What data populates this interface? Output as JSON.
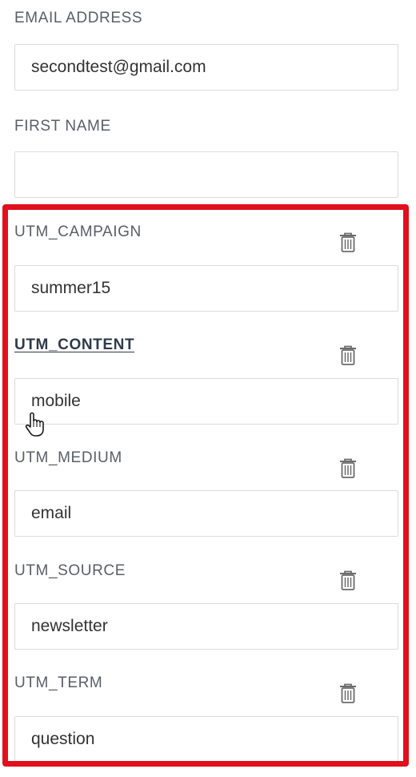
{
  "fields": {
    "email": {
      "label": "EMAIL ADDRESS",
      "value": "secondtest@gmail.com"
    },
    "first_name": {
      "label": "FIRST NAME",
      "value": ""
    },
    "utm_campaign": {
      "label": "UTM_CAMPAIGN",
      "value": "summer15"
    },
    "utm_content": {
      "label": "UTM_CONTENT",
      "value": "mobile"
    },
    "utm_medium": {
      "label": "UTM_MEDIUM",
      "value": "email"
    },
    "utm_source": {
      "label": "UTM_SOURCE",
      "value": "newsletter"
    },
    "utm_term": {
      "label": "UTM_TERM",
      "value": "question"
    }
  },
  "icons": {
    "delete": "trash-icon",
    "pointer": "hand-cursor-icon"
  },
  "colors": {
    "highlight": "#e0101c",
    "label": "#5a5f66",
    "hovered_label": "#2f3a4a"
  }
}
